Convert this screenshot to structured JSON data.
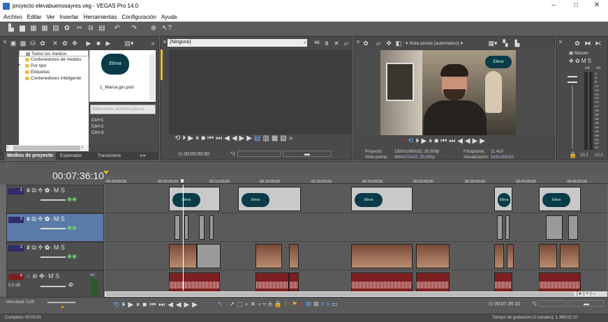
{
  "window": {
    "title": "proyecto elevabuenosayres.veg - VEGAS Pro 14.0",
    "minimize": "–",
    "maximize": "□",
    "close": "✕"
  },
  "menu": [
    "Archivo",
    "Editar",
    "Ver",
    "Insertar",
    "Herramientas",
    "Configuración",
    "Ayuda"
  ],
  "explorer": {
    "tree": [
      "Todos los medios",
      "Contenedores de medios",
      "Por tipo",
      "Etiquetas",
      "Contenedores inteligente"
    ],
    "media_item": "1_Marca.jpn.psd",
    "search_placeholder": "Seleccionar archivos para e",
    "shortcuts": [
      "Ctrl+1",
      "Ctrl+2",
      "Ctrl+3"
    ],
    "tabs": [
      "Medios de proyecto",
      "Explorador",
      "Transicione"
    ]
  },
  "trimmer": {
    "dropdown": "(Ninguno)",
    "timecode": "00:00:00:00"
  },
  "preview": {
    "mode": "Vista previa (automático)",
    "proyecto_label": "Proyecto:",
    "proyecto_val": "1920x1080x32; 25,000p",
    "vista_label": "Vista previa:",
    "vista_val": "480x270x32; 25,000p",
    "fotograma_label": "Fotograma:",
    "fotograma_val": "11.410",
    "visual_label": "Visualización:",
    "visual_val": "343x193x32",
    "logo": "Eleva"
  },
  "master": {
    "title": "Master",
    "m": "M",
    "s": "S",
    "inf": "-Inf.",
    "levels": [
      "3",
      "6",
      "9",
      "12",
      "15",
      "18",
      "21",
      "24",
      "27",
      "30",
      "33",
      "36",
      "39",
      "42",
      "45",
      "48",
      "51",
      "54",
      "57"
    ],
    "bottom_left": "10.2",
    "bottom_right": "10.2"
  },
  "timeline": {
    "timecode": "00:07:36:10",
    "ruler": [
      "00:00:00;00",
      "00:05:00;00",
      "00:10:00;00",
      "00:15:00;00",
      "00:20:00;00",
      "00:25:00;00",
      "00:30:00;00",
      "00:35:00;00",
      "00:40:00;00",
      "00:45:00;00"
    ],
    "tracks": [
      {
        "num": "1",
        "m": "M",
        "s": "S"
      },
      {
        "num": "2",
        "m": "M",
        "s": "S"
      },
      {
        "num": "3",
        "m": "M",
        "s": "S"
      },
      {
        "num": "4",
        "m": "M",
        "s": "S",
        "db": "0,0 dB",
        "inf": "-Inf."
      }
    ],
    "clip_logo": "Eleva"
  },
  "status": {
    "velocidad": "Velocidad: 0,00",
    "completo": "Completo: 00:00:01",
    "timecode": "00:07:36:10",
    "grabacion": "Tiempo de grabación (2 canales): 1.386:02:10"
  }
}
